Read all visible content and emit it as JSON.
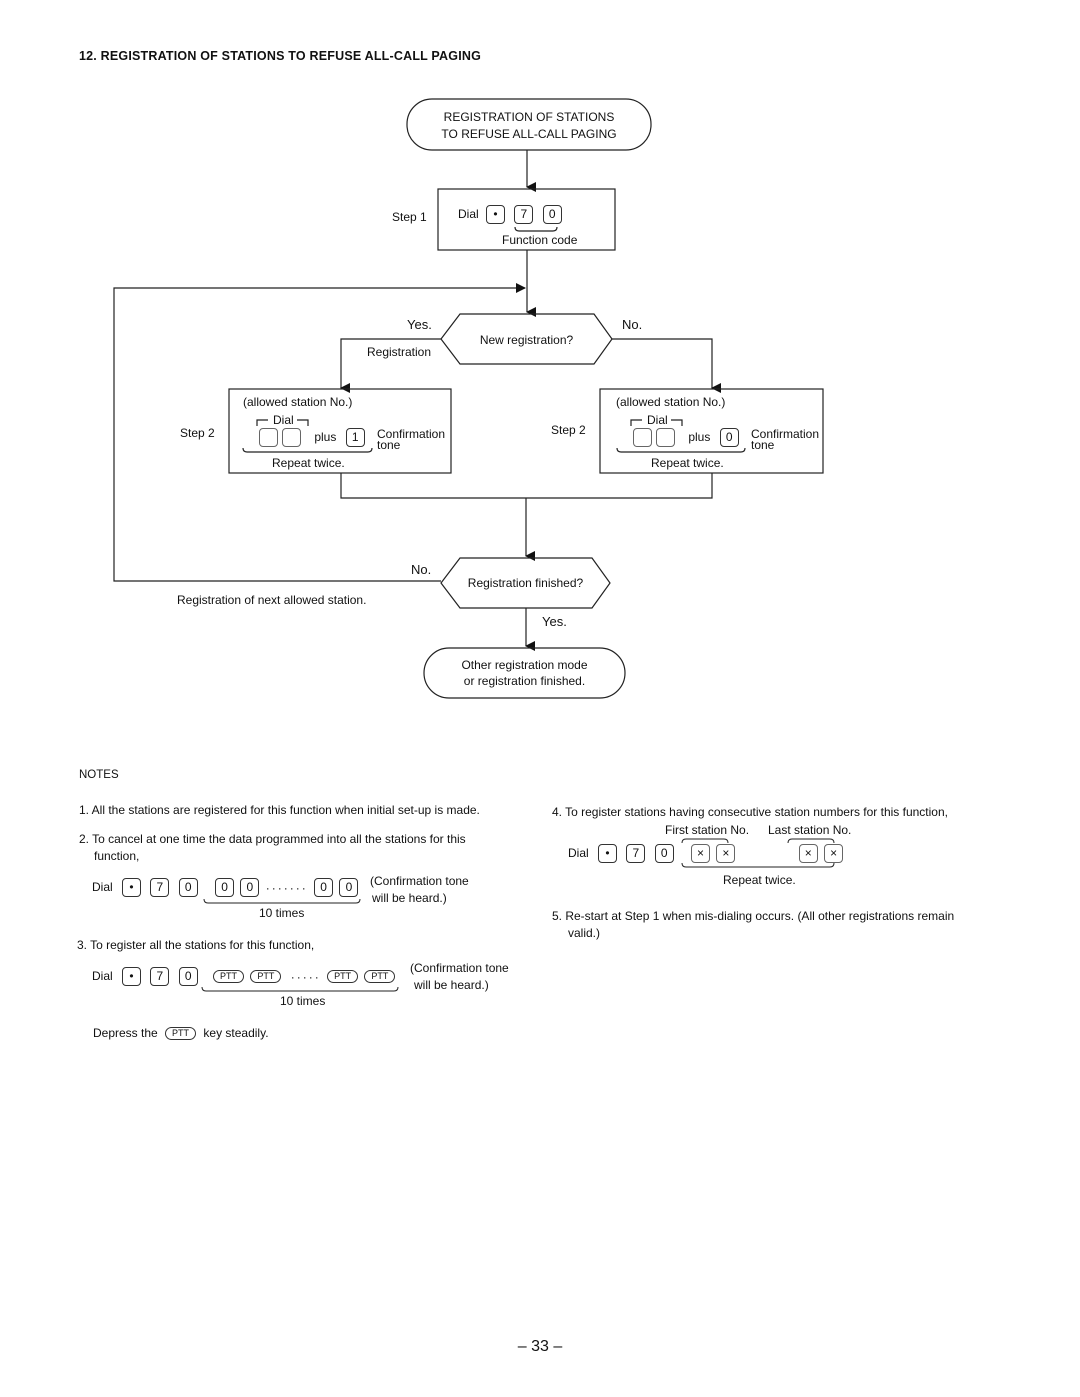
{
  "section_title": "12.  REGISTRATION  OF  STATIONS  TO  REFUSE  ALL-CALL  PAGING",
  "flowchart": {
    "start": {
      "line1": "REGISTRATION  OF  STATIONS",
      "line2": "TO  REFUSE  ALL-CALL  PAGING"
    },
    "step1": {
      "label": "Step  1",
      "dial": "Dial",
      "keys": [
        "•",
        "7",
        "0"
      ],
      "caption": "Function  code"
    },
    "decision1": {
      "text": "New  registration?",
      "yes": "Yes.",
      "no": "No.",
      "yes_branch_label": "Registration"
    },
    "step2_left": {
      "label": "Step  2",
      "header": "(allowed station No.)",
      "dial": "Dial",
      "plus": "plus",
      "key": "1",
      "tone1": "Confirmation",
      "tone2": "tone",
      "repeat": "Repeat  twice."
    },
    "step2_right": {
      "label": "Step  2",
      "header": "(allowed station No.)",
      "dial": "Dial",
      "plus": "plus",
      "key": "0",
      "tone1": "Confirmation",
      "tone2": "tone",
      "repeat": "Repeat  twice."
    },
    "decision2": {
      "text": "Registration  finished?",
      "yes": "Yes.",
      "no": "No.",
      "no_branch_label": "Registration  of  next  allowed  station."
    },
    "end": {
      "line1": "Other  registration  mode",
      "line2": "or  registration  finished."
    }
  },
  "notes": {
    "heading": "NOTES",
    "n1": "1.  All the stations are registered for this function when initial set-up is made.",
    "n2a": "2.  To cancel at one time the data programmed into all the stations for this",
    "n2b": "function,",
    "n2_dial": "Dial",
    "n2_keys": [
      "•",
      "7",
      "0"
    ],
    "n2_repeat_keys": [
      "0",
      "0",
      "0",
      "0"
    ],
    "n2_dots": "·······",
    "n2_times": "10  times",
    "n2_tone1": "(Confirmation  tone",
    "n2_tone2": "will  be  heard.)",
    "n3": "3.  To  register  all  the  stations  for  this  function,",
    "n3_dial": "Dial",
    "n3_keys": [
      "•",
      "7",
      "0"
    ],
    "n3_ptt": [
      "PTT",
      "PTT",
      "PTT",
      "PTT"
    ],
    "n3_dots": "·····",
    "n3_times": "10  times",
    "n3_tone1": "(Confirmation  tone",
    "n3_tone2": "will  be  heard.)",
    "n3_depress_a": "Depress  the",
    "n3_depress_key": "PTT",
    "n3_depress_b": "key  steadily.",
    "n4": "4.  To register stations having consecutive station numbers for this function,",
    "n4_first": "First  station  No.",
    "n4_last": "Last  station  No.",
    "n4_dial": "Dial",
    "n4_keys": [
      "•",
      "7",
      "0"
    ],
    "n4_x": [
      "×",
      "×",
      "×",
      "×"
    ],
    "n4_repeat": "Repeat  twice.",
    "n5a": "5.  Re-start at Step 1 when mis-dialing occurs. (All other registrations remain",
    "n5b": "valid.)"
  },
  "page_number": "– 33 –"
}
